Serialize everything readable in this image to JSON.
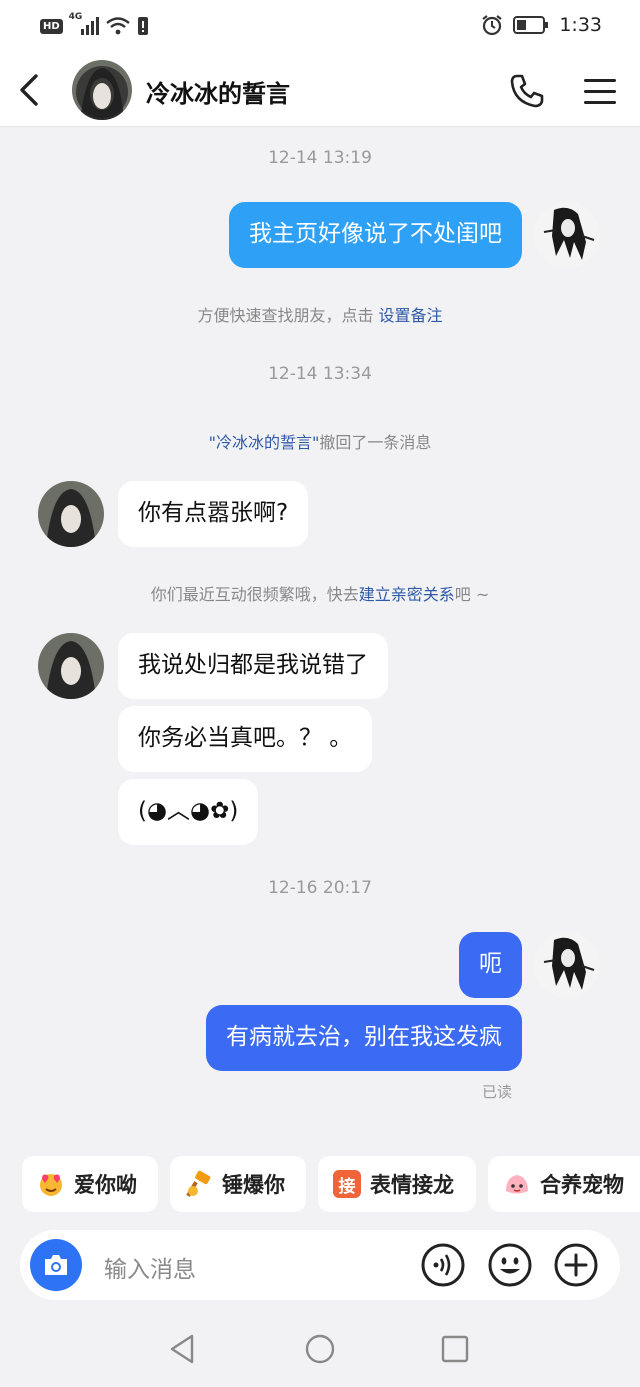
{
  "status_bar": {
    "hd": "HD",
    "network": "4G",
    "time": "1:33"
  },
  "header": {
    "title": "冷冰冰的誓言"
  },
  "messages": {
    "ts1": "12-14 13:19",
    "out1": "我主页好像说了不处闺吧",
    "sys1_text": "方便快速查找朋友，点击 ",
    "sys1_link": "设置备注",
    "ts2": "12-14 13:34",
    "sys2_link": "\"冷冰冰的誓言\"",
    "sys2_text": "撤回了一条消息",
    "in1": "你有点嚣张啊?",
    "sys3_pre": "你们最近互动很频繁哦，快去",
    "sys3_link": "建立亲密关系",
    "sys3_post": "吧 ~",
    "in2": "我说处归都是我说错了",
    "in3": "你务必当真吧。？ 。",
    "in4": "(◕︿◕✿)",
    "ts3": "12-16 20:17",
    "out2": "呃",
    "out3": "有病就去治，别在我这发疯",
    "read": "已读"
  },
  "quick_actions": [
    {
      "label": "爱你呦",
      "icon": "heart-face-icon"
    },
    {
      "label": "锤爆你",
      "icon": "hammer-icon"
    },
    {
      "label": "表情接龙",
      "icon": "jie-icon",
      "badge": "接"
    },
    {
      "label": "合养宠物",
      "icon": "pet-icon"
    }
  ],
  "input": {
    "placeholder": "输入消息"
  },
  "colors": {
    "outgoing_bubble_1": "#2ea0f6",
    "outgoing_bubble_2": "#3a6bf2",
    "camera": "#2f73f5",
    "link": "#2e5aa8"
  }
}
